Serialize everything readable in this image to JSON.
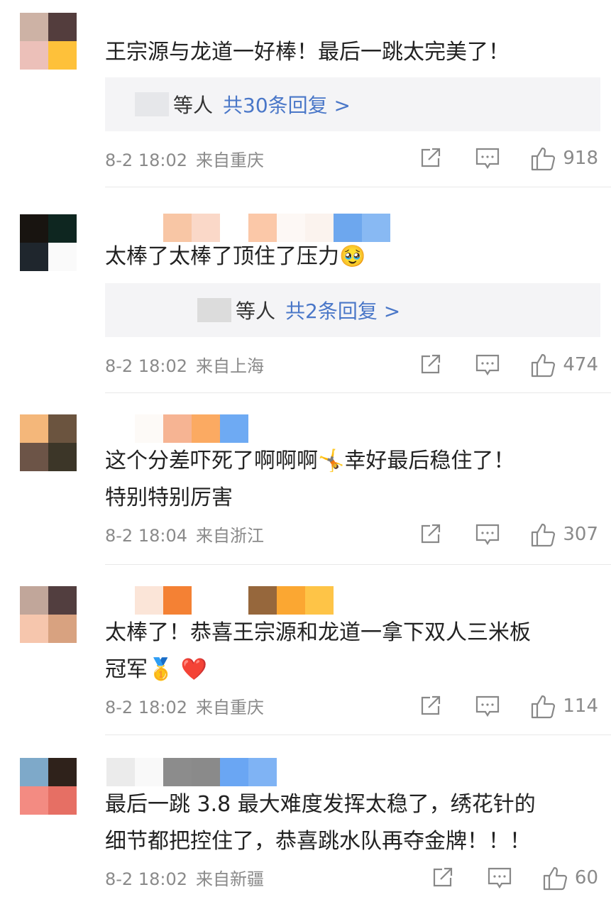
{
  "comments": [
    {
      "text": "王宗源与龙道一好棒！最后一跳太完美了！",
      "reply_who": "等人",
      "reply_link": "共30条回复 >",
      "time": "8-2 18:02",
      "location": "来自重庆",
      "likes": "918",
      "avatar_colors": [
        "#cdb2a5",
        "#533d3d",
        "#ecc0b9",
        "#fec13a"
      ],
      "name_colors": []
    },
    {
      "text": "太棒了太棒了顶住了压力",
      "emoji": "🥹",
      "reply_who": "等人",
      "reply_link": "共2条回复 >",
      "time": "8-2 18:02",
      "location": "来自上海",
      "likes": "474",
      "avatar_colors": [
        "#181410",
        "#0e2620",
        "#1f262d",
        "#fafafa"
      ],
      "name_colors": [
        "#ffffff",
        "#f8c6a5",
        "#fad8c8",
        "#ffffff",
        "#fbc8a8",
        "#fdf8f5",
        "#fbf3ee",
        "#6da7ee",
        "#88b9f3"
      ]
    },
    {
      "text_line1": "这个分差吓死了啊啊啊",
      "emoji": "🤸",
      "text_line1b": "幸好最后稳住了！",
      "text_line2": "特别特别厉害",
      "time": "8-2 18:04",
      "location": "来自浙江",
      "likes": "307",
      "avatar_colors": [
        "#f4b77a",
        "#6b543f",
        "#6c5447",
        "#3c3628"
      ],
      "name_colors": [
        "#fdfaf7",
        "#f6b493",
        "#fbaa62",
        "#6eaaf3"
      ]
    },
    {
      "text_line1": "太棒了！恭喜王宗源和龙道一拿下双人三米板",
      "text_line2": "冠军",
      "emoji1": "🥇",
      "emoji2": "❤️",
      "time": "8-2 18:02",
      "location": "来自重庆",
      "likes": "114",
      "avatar_colors": [
        "#c1a69a",
        "#523e3f",
        "#f6c6ad",
        "#d8a280"
      ],
      "name_colors": [
        "#ffffff",
        "#fbe5d8",
        "#f48134",
        "#ffffff",
        "#ffffff",
        "#96673c",
        "#fba732",
        "#fec447"
      ]
    },
    {
      "text_line1": "最后一跳 3.8 最大难度发挥太稳了，绣花针的",
      "text_line2": "细节都把控住了，恭喜跳水队再夺金牌！！！",
      "time": "8-2 18:02",
      "location": "来自新疆",
      "likes": "60",
      "avatar_colors": [
        "#7ea9c9",
        "#2f221b",
        "#f38b82",
        "#e66f64"
      ],
      "name_colors": [
        "#ebebeb",
        "#f9f9f9",
        "#8c8c8c",
        "#8a8a8a",
        "#6aa6f3",
        "#7fb3f4"
      ]
    }
  ],
  "icons": {
    "share": "share-icon",
    "comment": "comment-icon",
    "like": "thumbs-up-icon"
  }
}
